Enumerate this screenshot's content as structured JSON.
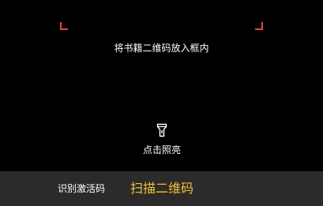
{
  "scanner": {
    "hint": "将书籍二维码放入框内",
    "frame_color": "#e8453c",
    "torch": {
      "icon": "flashlight-icon",
      "label": "点击照亮"
    }
  },
  "bottom_bar": {
    "background": "#2b2b2b",
    "tabs": [
      {
        "label": "识别激活码",
        "active": false
      },
      {
        "label": "扫描二维码",
        "active": true,
        "color": "#f2c230"
      }
    ]
  }
}
